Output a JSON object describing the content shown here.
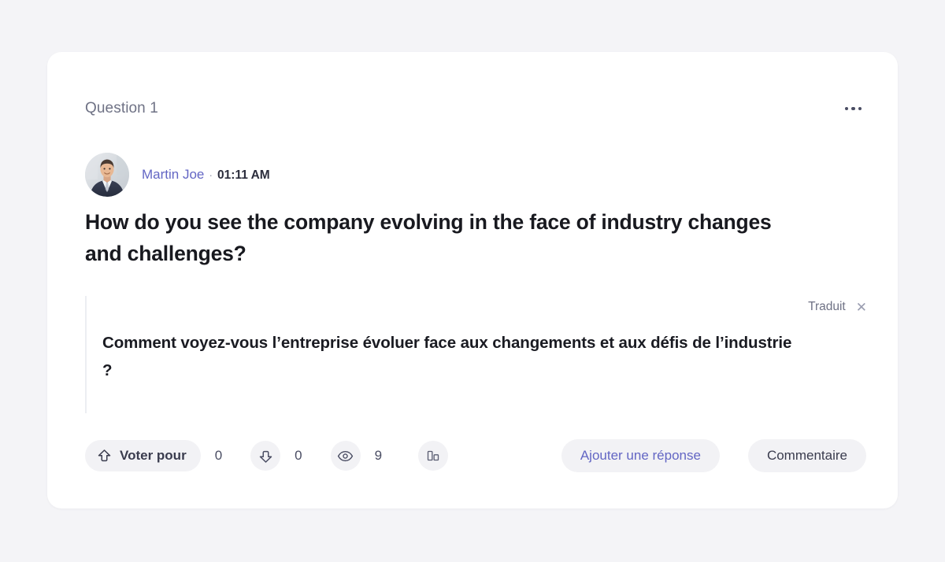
{
  "colors": {
    "page_background": "#f4f4f7",
    "card_background": "#ffffff",
    "accent": "#6366c4",
    "muted_text": "#6f7285",
    "pill_background": "#f2f2f5"
  },
  "card": {
    "question_label": "Question 1",
    "more_menu_icon": "ellipsis-horizontal-icon",
    "author": {
      "avatar_icon": "user-photo-avatar",
      "name": "Martin Joe",
      "separator": "·",
      "time": "01:11 AM"
    },
    "title": "How do you see the company evolving in the face of industry changes and challenges?",
    "translation": {
      "label": "Traduit",
      "close_icon": "close-icon",
      "text": "Comment voyez-vous l’entreprise évoluer face aux changements et aux défis de l’industrie ?"
    },
    "footer": {
      "upvote": {
        "icon": "arrow-up-vote-icon",
        "label": "Voter pour",
        "count": "0"
      },
      "downvote": {
        "icon": "arrow-down-vote-icon",
        "count": "0"
      },
      "views": {
        "icon": "eye-icon",
        "count": "9"
      },
      "stats": {
        "icon": "bar-chart-icon"
      },
      "add_answer_label": "Ajouter une réponse",
      "comment_label": "Commentaire"
    }
  }
}
